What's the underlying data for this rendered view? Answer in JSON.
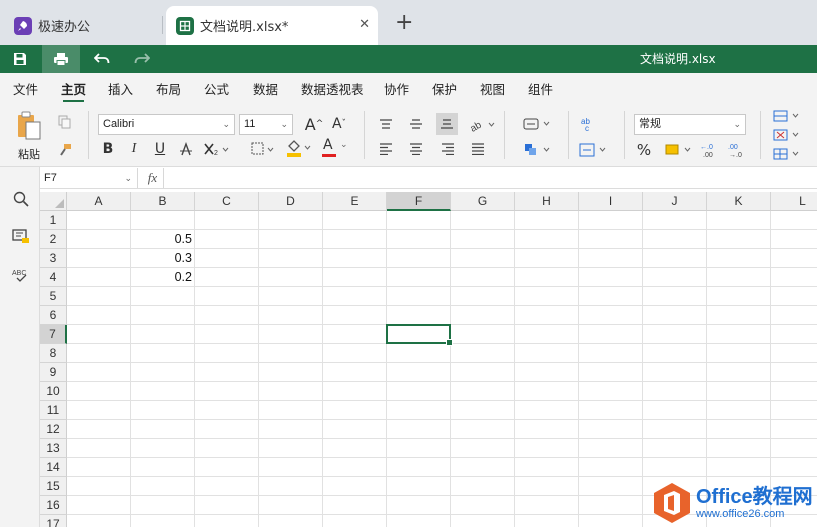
{
  "tabs": [
    {
      "label": "极速办公",
      "icon": "rocket-icon"
    },
    {
      "label": "文档说明.xlsx*",
      "icon": "spreadsheet-icon",
      "active": true
    }
  ],
  "quick": {
    "title": "文档说明.xlsx"
  },
  "menu": [
    "文件",
    "主页",
    "插入",
    "布局",
    "公式",
    "数据",
    "数据透视表",
    "协作",
    "保护",
    "视图",
    "组件"
  ],
  "menu_active": "主页",
  "ribbon": {
    "paste_label": "粘贴",
    "font_name": "Calibri",
    "font_size": "11",
    "number_format": "常规",
    "bold": "B",
    "italic": "I",
    "underline": "U",
    "font_color_label": "A",
    "grow_font": "A",
    "shrink_font": "A",
    "percent": "%"
  },
  "formula_bar": {
    "cell_ref": "F7",
    "fx": "fx",
    "content": ""
  },
  "sheet": {
    "columns": [
      "A",
      "B",
      "C",
      "D",
      "E",
      "F",
      "G",
      "H",
      "I",
      "J",
      "K",
      "L"
    ],
    "rows": [
      "1",
      "2",
      "3",
      "4",
      "5",
      "6",
      "7",
      "8",
      "9",
      "10",
      "11",
      "12",
      "13",
      "14",
      "15",
      "16",
      "17"
    ],
    "selected_column": "F",
    "selected_row": "7",
    "cells": [
      {
        "ref": "B2",
        "value": "0.5"
      },
      {
        "ref": "B3",
        "value": "0.3"
      },
      {
        "ref": "B4",
        "value": "0.2"
      }
    ]
  },
  "watermark": {
    "title": "Office教程网",
    "url": "www.office26.com"
  },
  "colors": {
    "brand_green": "#1e7145",
    "tab_bg": "#dfe3e8",
    "ribbon_bg": "#f3f3f3",
    "watermark_blue": "#1f6fd1",
    "watermark_orange": "#e8632b"
  }
}
